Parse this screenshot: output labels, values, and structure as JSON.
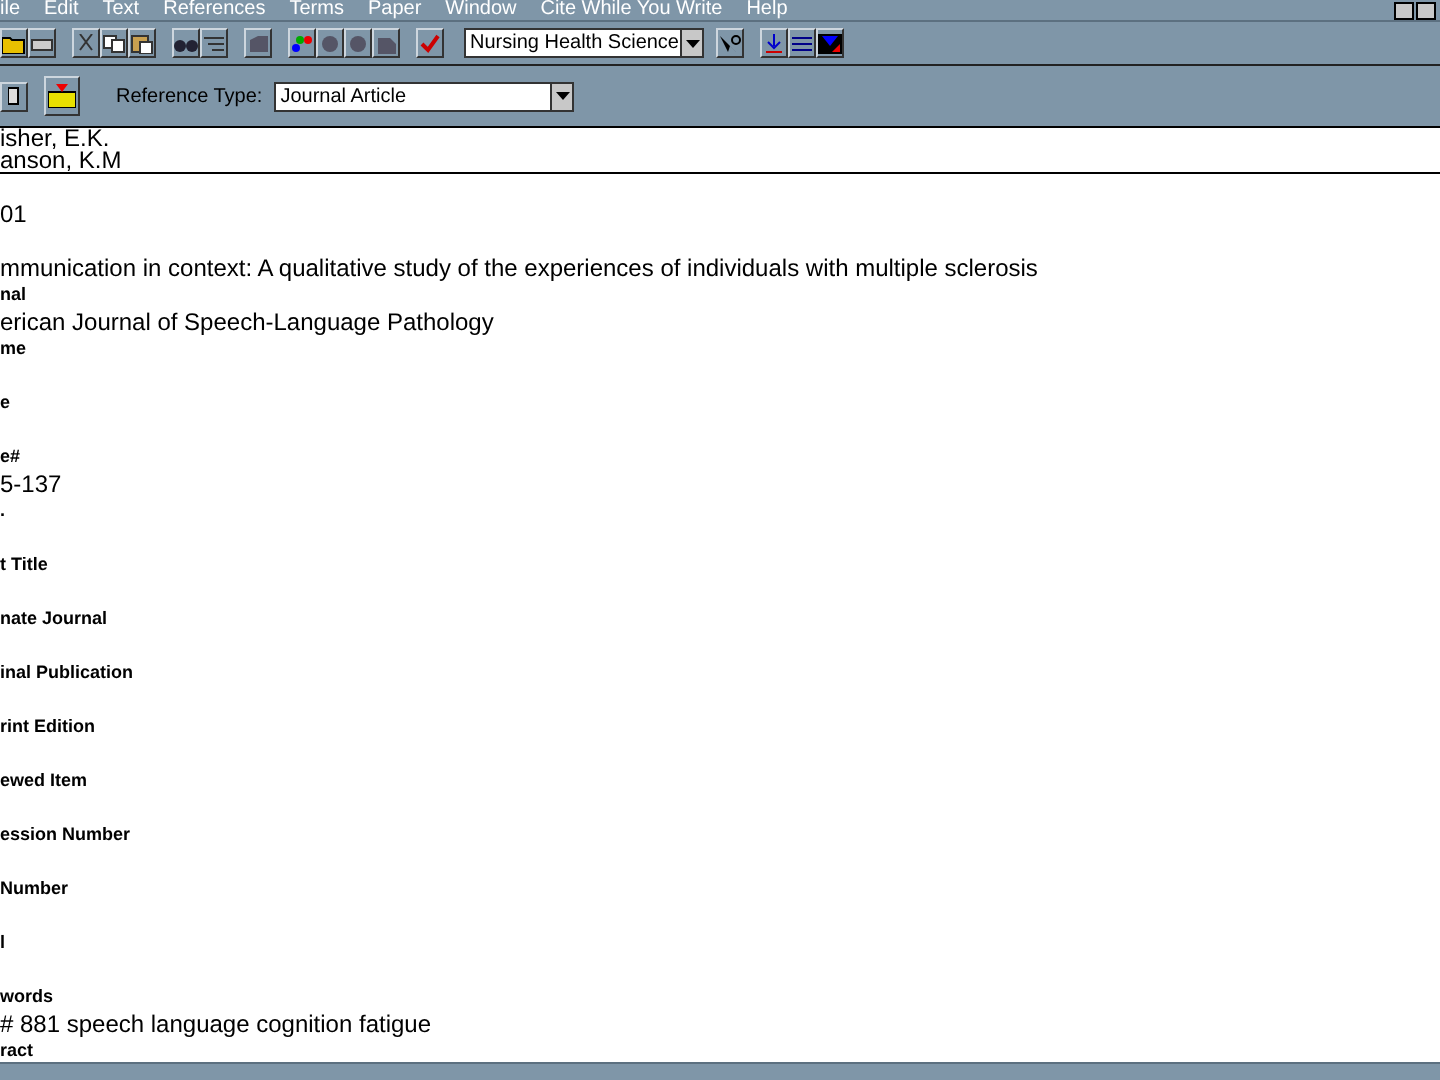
{
  "menu_bar": {
    "items": [
      "ile",
      "Edit",
      "Text",
      "References",
      "Terms",
      "Paper",
      "Window",
      "Cite While You Write",
      "Help"
    ]
  },
  "toolbar": {
    "library_dropdown": "Nursing Health Science"
  },
  "reference_toolbar": {
    "type_label": "Reference Type:",
    "type_dropdown": "Journal Article"
  },
  "authors": [
    "isher, E.K.",
    "anson, K.M"
  ],
  "fields": [
    {
      "value": "01"
    },
    {
      "value": "mmunication in context: A qualitative study of the experiences of individuals with multiple sclerosis"
    },
    {
      "label": "nal",
      "value": "erican Journal of Speech-Language Pathology"
    },
    {
      "label": "me"
    },
    {
      "label": "e"
    },
    {
      "label": "e#",
      "value": "5-137"
    },
    {
      "label": "."
    },
    {
      "label": "t Title"
    },
    {
      "label": "nate Journal"
    },
    {
      "label": "inal Publication"
    },
    {
      "label": "rint Edition"
    },
    {
      "label": "ewed Item"
    },
    {
      "label": "ession Number"
    },
    {
      "label": "Number"
    },
    {
      "label": "l"
    },
    {
      "label": "words",
      "value": "# 881 speech language cognition fatigue"
    },
    {
      "label": "ract"
    }
  ]
}
